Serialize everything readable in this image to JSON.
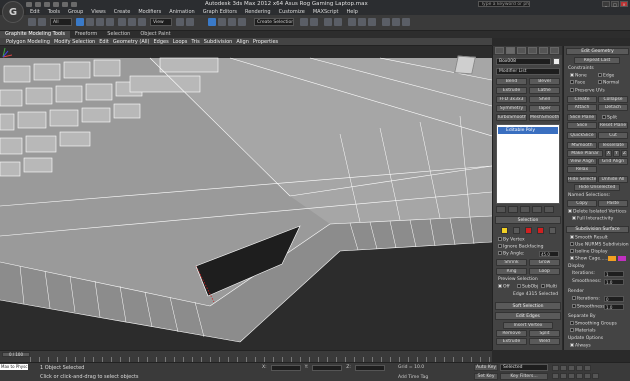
{
  "app": {
    "title": "Autodesk 3ds Max 2012 x64    Asus Rog Gaming Laptop.max",
    "search_placeholder": "Type a keyword or phrase"
  },
  "menu": [
    "Edit",
    "Tools",
    "Group",
    "Views",
    "Create",
    "Modifiers",
    "Animation",
    "Graph Editors",
    "Rendering",
    "Customize",
    "MAXScript",
    "Help"
  ],
  "toolbar": {
    "filter_value": "All",
    "view_value": "View",
    "selection_set": "Create Selection"
  },
  "ribbon": {
    "tabs": [
      "Graphite Modeling Tools",
      "Freeform",
      "Selection",
      "Object Paint"
    ],
    "active_tab": "Graphite Modeling Tools",
    "sub_items": [
      "Polygon Modeling",
      "Modify Selection",
      "Edit",
      "Geometry (All)",
      "Edges",
      "Loops",
      "Tris",
      "Subdivision",
      "Align",
      "Properties"
    ]
  },
  "viewport": {
    "label": "[+] [Perspective] [Realistic]"
  },
  "command_panel": {
    "object_name": "Box008",
    "modifier_list": "Modifier List",
    "modifier_buttons": [
      "Bend",
      "Bevel",
      "Extrude",
      "Lathe",
      "FFD 3x3x3",
      "Shell",
      "Symmetry",
      "Taper",
      "TurboSmooth",
      "MeshSmooth"
    ],
    "stack_item": "Editable Poly",
    "selection_title": "Selection",
    "by_vertex": "By Vertex",
    "ignore_backfacing": "Ignore Backfacing",
    "by_angle": "By Angle:",
    "by_angle_value": "45.0",
    "shrink": "Shrink",
    "grow": "Grow",
    "ring": "Ring",
    "loop": "Loop",
    "preview_selection": "Preview Selection",
    "preview_options": [
      "Off",
      "SubObj",
      "Multi"
    ],
    "selection_status": "Edge 4315 Selected",
    "soft_selection": "Soft Selection",
    "edit_edges": "Edit Edges",
    "insert_vertex": "Insert Vertex",
    "remove": "Remove",
    "split": "Split",
    "extrude": "Extrude",
    "weld": "Weld",
    "chamfer": "Chamfer",
    "target_weld": "Target Weld",
    "bridge": "Bridge",
    "connect": "Connect",
    "create_shape": "Create Shape From Selection",
    "weight_label": "Weight:",
    "weight_value": "1.0",
    "crease_label": "Crease:",
    "crease_value": "0.0"
  },
  "right_panel": {
    "edit_geometry": "Edit Geometry",
    "repeat_last": "Repeat Last",
    "constraints": "Constraints",
    "constraint_options": [
      "None",
      "Edge",
      "Face",
      "Normal"
    ],
    "preserve_uvs": "Preserve UVs",
    "create": "Create",
    "collapse": "Collapse",
    "attach": "Attach",
    "detach": "Detach",
    "slice_plane": "Slice Plane",
    "split": "Split",
    "slice": "Slice",
    "reset_plane": "Reset Plane",
    "quickslice": "QuickSlice",
    "cut": "Cut",
    "msmooth": "MSmooth",
    "tessellate": "Tessellate",
    "make_planar": "Make Planar",
    "axes": [
      "X",
      "Y",
      "Z"
    ],
    "view_align": "View Align",
    "grid_align": "Grid Align",
    "relax": "Relax",
    "hide_selected": "Hide Selected",
    "unhide_all": "Unhide All",
    "hide_unselected": "Hide Unselected",
    "named_selections": "Named Selections:",
    "copy": "Copy",
    "paste": "Paste",
    "delete_isolated": "Delete Isolated Vertices",
    "full_interactivity": "Full Interactivity",
    "subdivision_surface": "Subdivision Surface",
    "smooth_result": "Smooth Result",
    "use_nurms": "Use NURMS Subdivision",
    "isoline_display": "Isoline Display",
    "show_cage": "Show Cage......",
    "display": "Display",
    "iterations_label": "Iterations:",
    "iterations_value": "1",
    "smoothness_label": "Smoothness:",
    "smoothness_value": "1.0",
    "render": "Render",
    "render_iterations_value": "0",
    "render_smoothness_value": "1.0",
    "separate_by": "Separate By",
    "smoothing_groups": "Smoothing Groups",
    "materials": "Materials",
    "update_options": "Update Options",
    "always": "Always",
    "when_rendering": "When Rendering",
    "manually": "Manually"
  },
  "timeline": {
    "slider": "0 / 100",
    "ticks": [
      "0",
      "5",
      "10",
      "15",
      "20",
      "25",
      "30",
      "35",
      "40",
      "45",
      "50",
      "55",
      "60",
      "65",
      "70",
      "75",
      "80",
      "85",
      "90",
      "95",
      "100"
    ]
  },
  "status": {
    "maxscript": "Max to Physc",
    "selection": "1 Object Selected",
    "hint": "Click or click-and-drag to select objects",
    "x_label": "X:",
    "y_label": "Y:",
    "z_label": "Z:",
    "grid": "Grid = 10.0",
    "add_time_tag": "Add Time Tag",
    "auto_key": "Auto Key",
    "set_key": "Set Key",
    "key_mode": "Selected",
    "key_filters": "Key Filters..."
  },
  "colors": {
    "viewport_bg": "#2c2c2c",
    "mesh_fill": "#9a9a9a",
    "wire": "#ffffff",
    "accent": "#3a6fc0",
    "selection_yellow": "#f2d024",
    "selection_red": "#d02020"
  }
}
